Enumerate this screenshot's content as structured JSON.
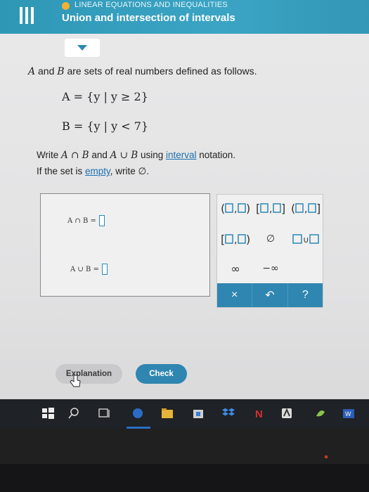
{
  "header": {
    "topic": "LINEAR EQUATIONS AND INEQUALITIES",
    "title": "Union and intersection of intervals"
  },
  "problem": {
    "intro_A": "A",
    "intro_mid": " and ",
    "intro_B": "B",
    "intro_rest": " are sets of real numbers defined as follows.",
    "set_a": "A = {y | y ≥ 2}",
    "set_b": "B = {y | y < 7}",
    "instr1_pre": "Write ",
    "instr1_inter": "A ∩ B",
    "instr1_and": " and ",
    "instr1_union": "A ∪ B",
    "instr1_using": " using ",
    "instr1_link": "interval",
    "instr1_post": " notation.",
    "instr2_pre": "If the set is ",
    "instr2_link": "empty",
    "instr2_post": ", write ∅."
  },
  "answers": {
    "intersection_label": "A ∩ B =",
    "union_label": "A ∪ B ="
  },
  "keypad": {
    "empty_set": "∅",
    "infinity": "∞",
    "neg_infinity": "−∞",
    "clear": "×",
    "undo": "↶",
    "help": "?"
  },
  "buttons": {
    "explanation": "Explanation",
    "check": "Check"
  },
  "colors": {
    "header": "#3ba4c4",
    "accent": "#2f86b0",
    "topic_dot": "#f2b233"
  }
}
